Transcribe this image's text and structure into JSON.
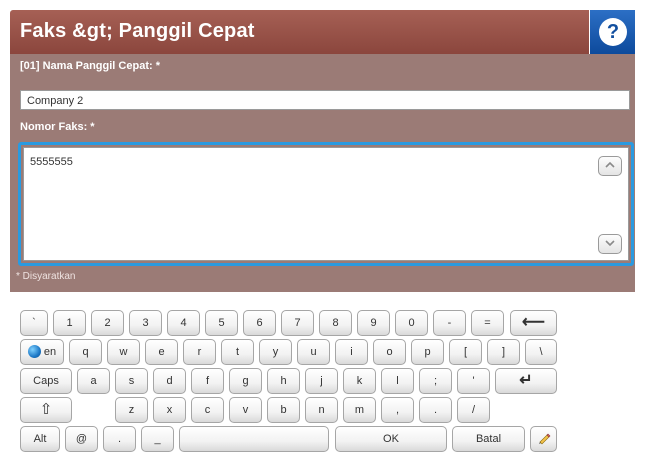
{
  "header": {
    "title": "Faks &gt; Panggil Cepat",
    "help_glyph": "?"
  },
  "form": {
    "name_label": "[01] Nama Panggil Cepat: *",
    "name_value": "Company 2",
    "fax_label": "Nomor Faks: *",
    "fax_value": "5555555",
    "scroll_up_glyph": "^",
    "scroll_down_glyph": "v",
    "required_note": "* Disyaratkan"
  },
  "keyboard": {
    "row1": [
      "`",
      "1",
      "2",
      "3",
      "4",
      "5",
      "6",
      "7",
      "8",
      "9",
      "0",
      "-",
      "=",
      "⟵"
    ],
    "row2": [
      "en",
      "q",
      "w",
      "e",
      "r",
      "t",
      "y",
      "u",
      "i",
      "o",
      "p",
      "[",
      "]",
      "\\"
    ],
    "row3": [
      "Caps",
      "a",
      "s",
      "d",
      "f",
      "g",
      "h",
      "j",
      "k",
      "l",
      ";",
      "'",
      "↵"
    ],
    "row4": [
      "⇧",
      "z",
      "x",
      "c",
      "v",
      "b",
      "n",
      "m",
      ",",
      ".",
      "/"
    ],
    "row5": [
      "Alt",
      "@",
      ".",
      "_",
      "",
      "OK",
      "Batal",
      ""
    ]
  },
  "colors": {
    "titlebar": "#8b463d",
    "form_bg": "#9b7b76",
    "focus_border": "#2a9ae0",
    "help_bg": "#0d4a9c"
  },
  "icons": {
    "help": "help-icon",
    "language": "globe-icon",
    "edit": "pencil-icon"
  }
}
